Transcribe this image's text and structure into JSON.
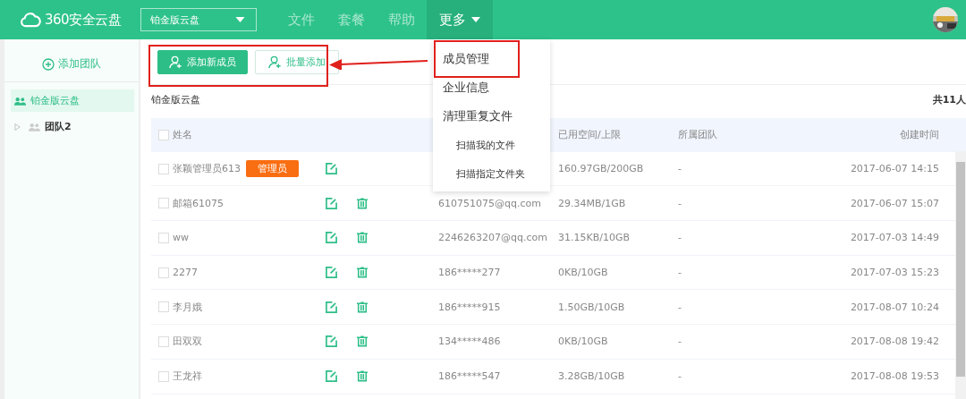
{
  "header": {
    "logo": "360安全云盘",
    "space_selector": "铂金版云盘",
    "nav": [
      {
        "label": "文件",
        "selected": false,
        "dropdown": false
      },
      {
        "label": "套餐",
        "selected": false,
        "dropdown": false
      },
      {
        "label": "帮助",
        "selected": false,
        "dropdown": false
      },
      {
        "label": "更多",
        "selected": true,
        "dropdown": true
      }
    ]
  },
  "dropdown": {
    "items": [
      {
        "label": "成员管理",
        "kind": "item"
      },
      {
        "label": "企业信息",
        "kind": "item"
      },
      {
        "label": "清理重复文件",
        "kind": "item"
      },
      {
        "label": "扫描我的文件",
        "kind": "subitem"
      },
      {
        "label": "扫描指定文件夹",
        "kind": "subitem"
      }
    ]
  },
  "sidebar": {
    "add_button": "添加团队",
    "tree": [
      {
        "label": "铂金版云盘",
        "selected": true
      },
      {
        "label": "团队2",
        "selected": false,
        "expanded": false
      }
    ]
  },
  "toolbar": {
    "buttons": [
      {
        "label": "添加新成员",
        "kind": "primary"
      },
      {
        "label": "批量添加",
        "kind": "secondary"
      }
    ]
  },
  "breadcrumb": "铂金版云盘",
  "total": "共11人",
  "table": {
    "all_checked": false,
    "columns": [
      "姓名",
      "已用空间/上限",
      "所属团队",
      "创建时间"
    ],
    "rows": [
      {
        "checked": false,
        "name": "张颖管理员613",
        "badge": "管理员",
        "can_delete": false,
        "usage": "160.97GB/200GB",
        "team": "-",
        "created": "2017-06-07 14:15"
      },
      {
        "checked": false,
        "name": "邮箱61075",
        "can_delete": true,
        "account": "610751075@qq.com",
        "usage": "29.34MB/1GB",
        "team": "-",
        "created": "2017-06-07 15:07"
      },
      {
        "checked": false,
        "name": "ww",
        "can_delete": true,
        "account": "2246263207@qq.com",
        "usage": "31.15KB/10GB",
        "team": "-",
        "created": "2017-07-03 14:49"
      },
      {
        "checked": false,
        "name": "2277",
        "can_delete": true,
        "account": "186*****277",
        "usage": "0KB/10GB",
        "team": "-",
        "created": "2017-07-03 15:23"
      },
      {
        "checked": false,
        "name": "李月娥",
        "can_delete": true,
        "account": "186*****915",
        "usage": "1.50GB/10GB",
        "team": "-",
        "created": "2017-08-07 10:24"
      },
      {
        "checked": false,
        "name": "田双双",
        "can_delete": true,
        "account": "134*****486",
        "usage": "0KB/10GB",
        "team": "-",
        "created": "2017-08-08 19:42"
      },
      {
        "checked": false,
        "name": "王龙祥",
        "can_delete": true,
        "account": "186*****547",
        "usage": "3.28GB/10GB",
        "team": "-",
        "created": "2017-08-08 19:53"
      }
    ]
  },
  "annotations": [
    {
      "kind": "frame"
    },
    {
      "kind": "frame"
    },
    {
      "kind": "arrow"
    }
  ]
}
